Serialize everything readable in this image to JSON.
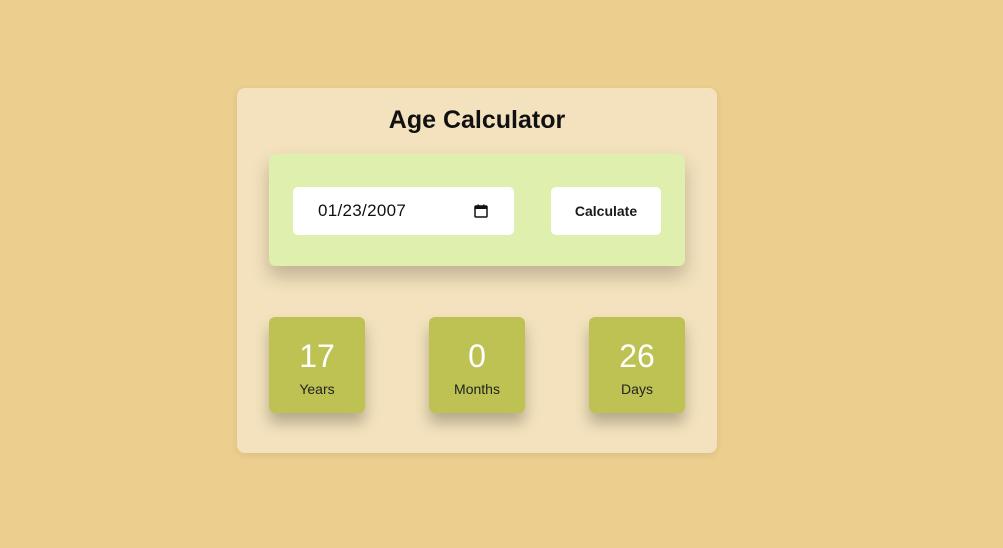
{
  "app": {
    "title": "Age Calculator"
  },
  "form": {
    "date_value": "01/23/2007",
    "calculate_label": "Calculate"
  },
  "results": [
    {
      "value": "17",
      "label": "Years"
    },
    {
      "value": "0",
      "label": "Months"
    },
    {
      "value": "26",
      "label": "Days"
    }
  ],
  "colors": {
    "background": "#ecce8e",
    "card": "#f3e2bd",
    "input_panel": "#deefae",
    "result_box": "#bec253"
  }
}
